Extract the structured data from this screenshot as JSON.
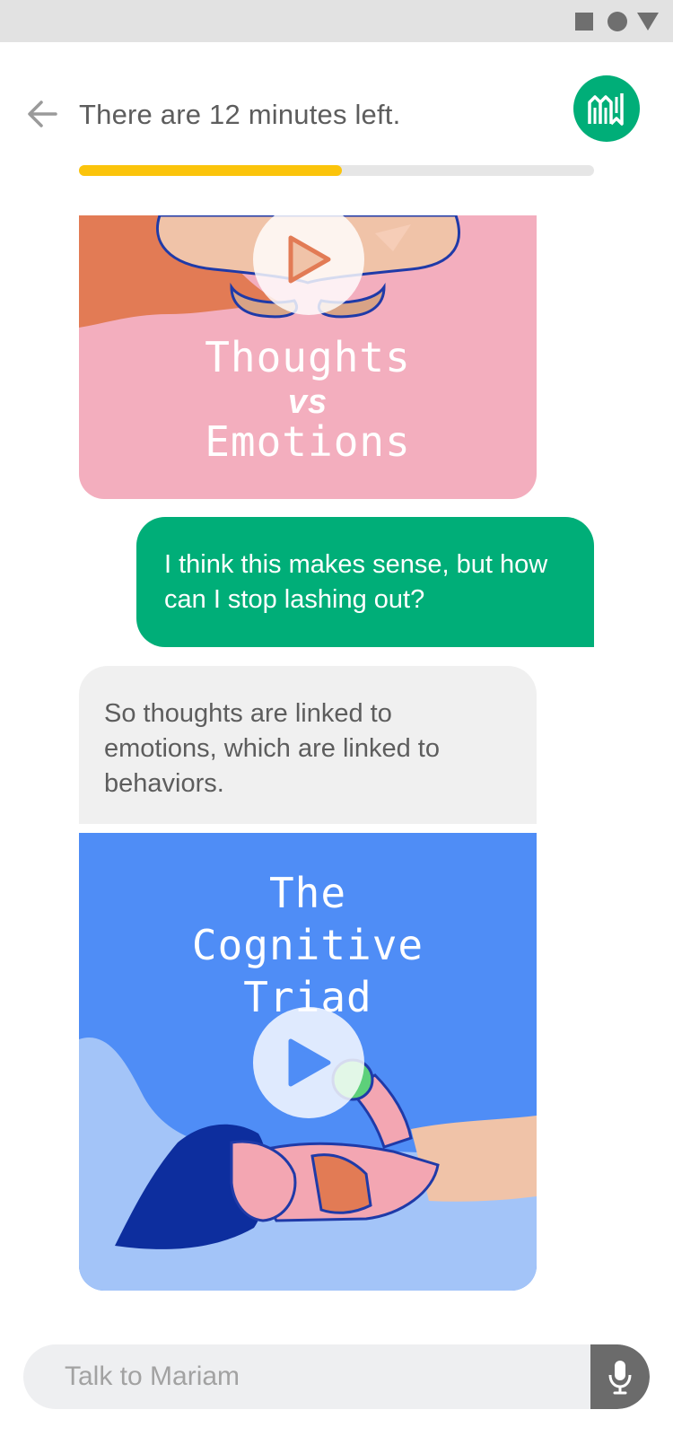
{
  "status_bar": {
    "icons": [
      "square-icon",
      "circle-icon",
      "triangle-icon"
    ]
  },
  "header": {
    "back_icon": "arrow-left-icon",
    "title": "There are 12 minutes left.",
    "avatar_icon": "brand-logo-icon"
  },
  "progress": {
    "fraction": 0.51
  },
  "messages": [
    {
      "type": "video",
      "title_line1": "Thoughts",
      "title_line2": "vs",
      "title_line3": "Emotions"
    },
    {
      "type": "user",
      "text": "I think this makes sense, but how can I stop lashing out?"
    },
    {
      "type": "bot",
      "text": "So thoughts are linked to emotions, which are linked to behaviors."
    },
    {
      "type": "video",
      "title_line1": "The",
      "title_line2": "Cognitive",
      "title_line3": "Triad"
    }
  ],
  "composer": {
    "placeholder": "Talk to Mariam",
    "mic_icon": "microphone-icon"
  },
  "colors": {
    "accent_green": "#00ae78",
    "progress_yellow": "#fbc40b",
    "card_pink": "#f3aebe",
    "card_blue": "#4f8df6"
  }
}
